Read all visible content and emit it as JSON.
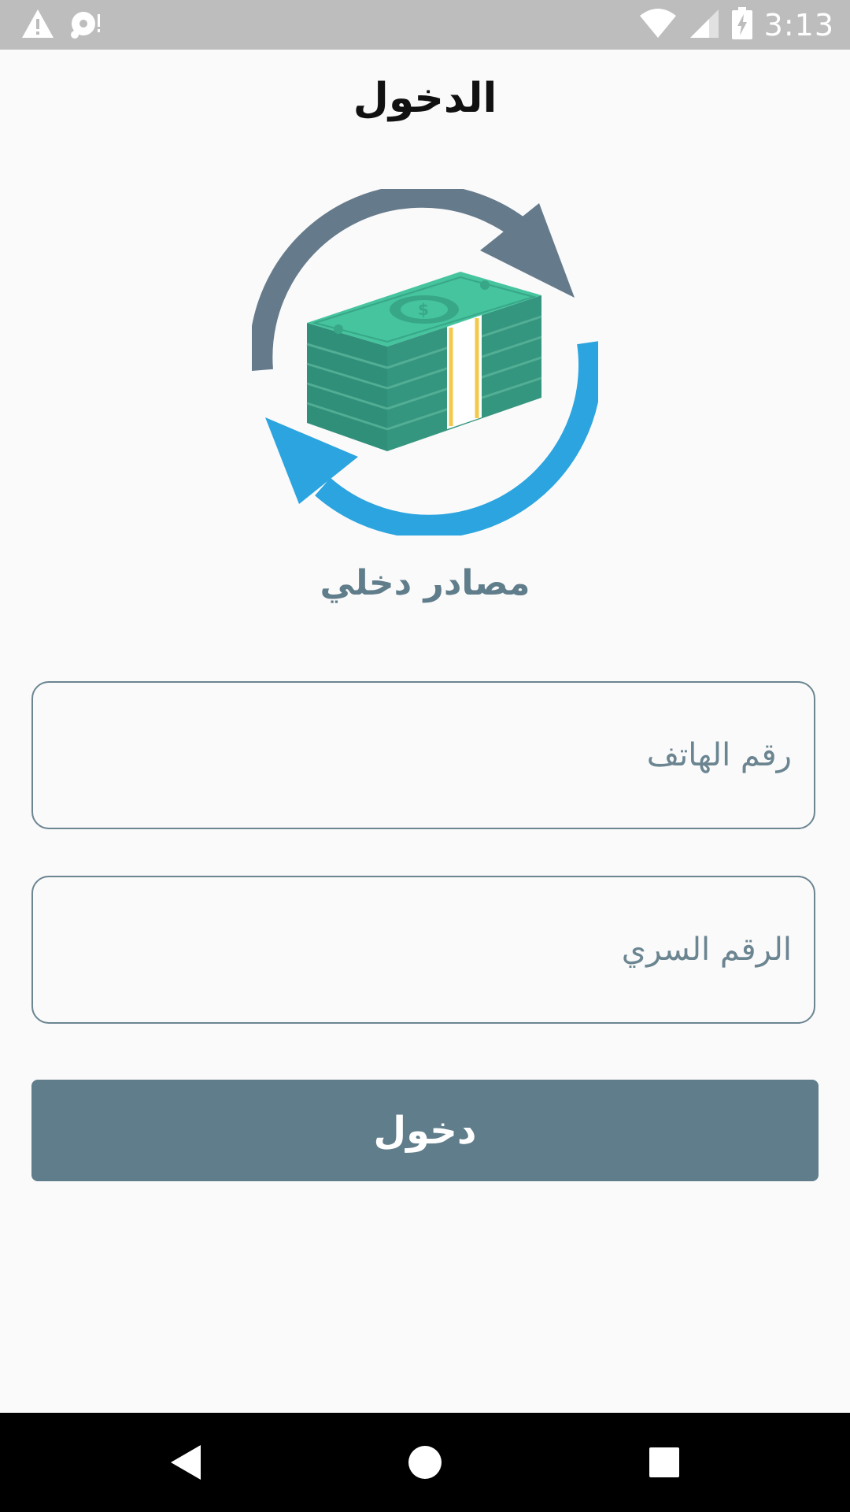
{
  "status_bar": {
    "time": "3:13",
    "icons": [
      "warning-icon",
      "notification-icon",
      "wifi-icon",
      "signal-icon",
      "battery-charging-icon"
    ]
  },
  "header": {
    "title": "الدخول"
  },
  "logo": {
    "icon": "money-exchange-icon",
    "colors": {
      "arrow_gray": "#657a8b",
      "arrow_blue": "#2ba4df",
      "bill_green": "#35967f",
      "bill_light": "#45c49e"
    }
  },
  "app": {
    "name": "مصادر دخلي"
  },
  "form": {
    "phone_placeholder": "رقم الهاتف",
    "phone_value": "",
    "pin_placeholder": "الرقم السري",
    "pin_value": "",
    "submit_label": "دخول"
  },
  "colors": {
    "primary": "#607d8b",
    "background": "#fafafa",
    "status_bar": "#bdbdbd"
  },
  "nav_bar": {
    "icons": [
      "back-icon",
      "home-icon",
      "recents-icon"
    ]
  }
}
